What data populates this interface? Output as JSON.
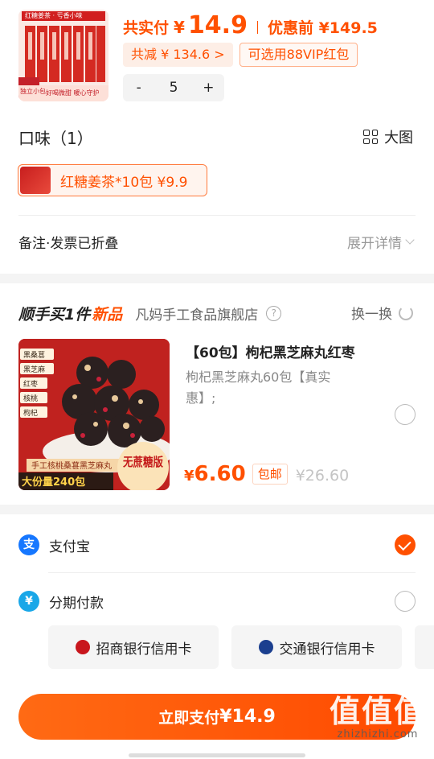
{
  "product": {
    "thumb_banner": "红糖姜茶 · 亏香小味",
    "thumb_badge": "独立小包",
    "thumb_caption": "好喝微甜 暖心守护",
    "paid_label": "共实付",
    "currency": "¥",
    "paid_amount": "14.9",
    "before_discount": "优惠前 ¥149.5",
    "total_saved": "共减 ¥ 134.6 >",
    "vip_coupon": "可选用88VIP红包",
    "qty_minus": "-",
    "quantity": "5",
    "qty_plus": "+"
  },
  "flavor": {
    "title": "口味（1）",
    "big_view": "大图",
    "selected": "红糖姜茶*10包  ¥9.9"
  },
  "remark": {
    "label": "备注·发票已折叠",
    "expand": "展开详情"
  },
  "addon": {
    "title_a": "顺手买1件",
    "title_b": "新品",
    "shop": "凡妈手工食品旗舰店",
    "help": "?",
    "swap": "换一换",
    "img_tags": [
      "黑桑葚",
      "黑芝麻",
      "红枣",
      "核桃",
      "枸杞"
    ],
    "img_banner": "手工核桃桑葚黑芝麻丸",
    "img_badge_left": "大份量240包",
    "img_badge_right": "无蔗糖版",
    "name": "【60包】枸杞黑芝麻丸红枣",
    "desc": "枸杞黑芝麻丸60包【真实惠】;",
    "yen": "¥",
    "price": "6.60",
    "shipping": "包邮",
    "was_price": "¥26.60"
  },
  "payment": {
    "alipay_icon": "支",
    "alipay": "支付宝",
    "installment_icon": "¥",
    "installment": "分期付款",
    "bank1": "招商银行信用卡",
    "bank2": "交通银行信用卡",
    "pay_label": "立即支付",
    "pay_amount": "¥14.9",
    "watermark": "值值值",
    "watermark_url": "zhizhizhi.com"
  },
  "colors": {
    "accent": "#ff5000",
    "alipay": "#1677ff",
    "installment": "#19a7e8"
  }
}
